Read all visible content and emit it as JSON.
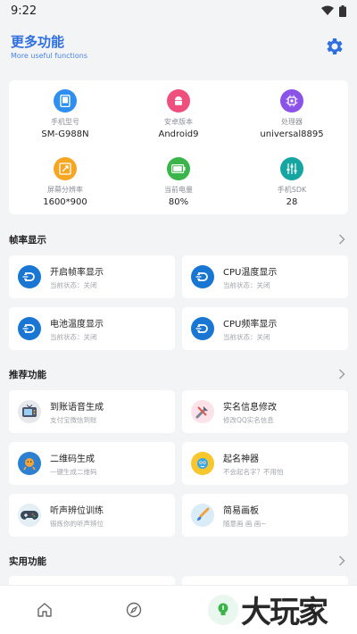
{
  "status_bar": {
    "time": "9:22"
  },
  "header": {
    "title": "更多功能",
    "subtitle": "More useful functions"
  },
  "device_info": [
    {
      "label": "手机型号",
      "value": "SM-G988N",
      "icon": "phone-icon",
      "color": "#2f8ff0"
    },
    {
      "label": "安卓版本",
      "value": "Android9",
      "icon": "android-icon",
      "color": "#ee4f7c"
    },
    {
      "label": "处理器",
      "value": "universal8895",
      "icon": "chip-icon",
      "color": "#8a52e8"
    },
    {
      "label": "屏幕分辨率",
      "value": "1600*900",
      "icon": "resolution-icon",
      "color": "#f5a623"
    },
    {
      "label": "当前电量",
      "value": "80%",
      "icon": "battery-icon",
      "color": "#3bb54a"
    },
    {
      "label": "手机SDK",
      "value": "28",
      "icon": "sliders-icon",
      "color": "#16a5a0"
    }
  ],
  "sections": {
    "frame": {
      "title": "帧率显示"
    },
    "recommended": {
      "title": "推荐功能"
    },
    "practical": {
      "title": "实用功能"
    }
  },
  "frame_tiles": [
    {
      "title": "开启帧率显示",
      "subtitle": "当前状态：关闭"
    },
    {
      "title": "CPU温度显示",
      "subtitle": "当前状态：关闭"
    },
    {
      "title": "电池温度显示",
      "subtitle": "当前状态：关闭"
    },
    {
      "title": "CPU频率显示",
      "subtitle": "当前状态：关闭"
    }
  ],
  "recommended_tiles": [
    {
      "title": "到账语音生成",
      "subtitle": "支付宝微信到账",
      "icon": "tv-icon"
    },
    {
      "title": "实名信息修改",
      "subtitle": "修改QQ实名信息",
      "icon": "wrench-icon"
    },
    {
      "title": "二维码生成",
      "subtitle": "一键生成二维码",
      "icon": "qrcode-character-icon"
    },
    {
      "title": "起名神器",
      "subtitle": "不会起名字？不用怕",
      "icon": "name-character-icon"
    },
    {
      "title": "听声辨位训练",
      "subtitle": "锻炼你的听声辨位",
      "icon": "gamepad-icon"
    },
    {
      "title": "简易画板",
      "subtitle": "随意画 画 画~",
      "icon": "paintbrush-icon"
    }
  ],
  "watermark": "大玩家",
  "colors": {
    "accent": "#2f6fe0",
    "tile_icon_blue": "#1976d2"
  }
}
